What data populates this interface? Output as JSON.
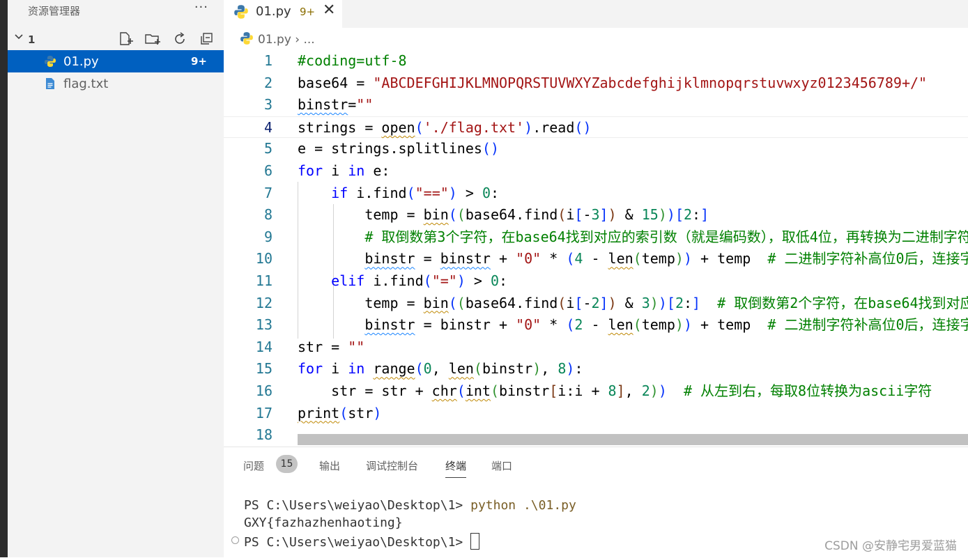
{
  "sidebar": {
    "title": "资源管理器",
    "more": "···",
    "folder": "1",
    "files": [
      {
        "name": "01.py",
        "badge": "9+",
        "icon": "python-icon",
        "selected": true
      },
      {
        "name": "flag.txt",
        "badge": "",
        "icon": "text-file-icon",
        "selected": false
      }
    ]
  },
  "tab": {
    "name": "01.py",
    "badge": "9+",
    "close": "✕"
  },
  "breadcrumb": {
    "file": "01.py",
    "rest": "› ..."
  },
  "editor": {
    "current_line": 4,
    "line_numbers": [
      "1",
      "2",
      "3",
      "4",
      "5",
      "6",
      "7",
      "8",
      "9",
      "10",
      "11",
      "12",
      "13",
      "14",
      "15",
      "16",
      "17",
      "18"
    ]
  },
  "panel": {
    "tabs": [
      "问题",
      "输出",
      "调试控制台",
      "终端",
      "端口"
    ],
    "problems_count": "15",
    "active_tab": "终端",
    "terminal": {
      "prompt1": "PS C:\\Users\\weiyao\\Desktop\\1> ",
      "command": "python .\\01.py",
      "output": "GXY{fazhazhenhaoting}",
      "prompt2": "PS C:\\Users\\weiyao\\Desktop\\1> "
    }
  },
  "watermark": "CSDN @安静宅男爱蓝猫",
  "colors": {
    "accent": "#0060c0",
    "keyword": "#0000ff",
    "comment": "#008000",
    "string": "#a31515",
    "number": "#098658"
  }
}
